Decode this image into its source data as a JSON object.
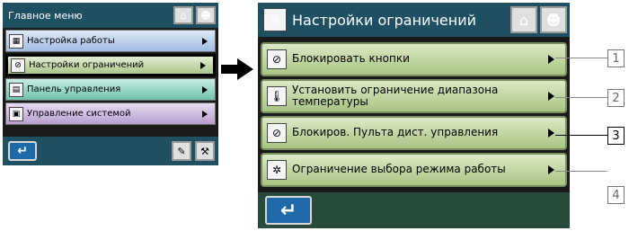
{
  "main_menu": {
    "title": "Главное меню",
    "items": [
      {
        "label": "Настройка работы",
        "icon": "settings-icon"
      },
      {
        "label": "Настройки ограничений",
        "icon": "restriction-icon"
      },
      {
        "label": "Панель управления",
        "icon": "panel-icon"
      },
      {
        "label": "Управление системой",
        "icon": "system-icon"
      }
    ]
  },
  "restrictions": {
    "title": "Настройки ограничений",
    "items": [
      {
        "label": "Блокировать кнопки",
        "icon": "button-lock-icon"
      },
      {
        "label": "Установить ограничение диапазона температуры",
        "icon": "thermometer-icon"
      },
      {
        "label": "Блокиров. Пульта дист. управления",
        "icon": "remote-lock-icon"
      },
      {
        "label": "Ограничение выбора режима работы",
        "icon": "mode-restrict-icon"
      }
    ]
  },
  "callouts": [
    "1",
    "2",
    "3",
    "4"
  ],
  "icons": {
    "home": "⌂",
    "user": "☻",
    "back": "↵"
  },
  "colors": {
    "header": "#1e4f63",
    "item_green": "#a9c483",
    "back_blue": "#1e6aa8"
  }
}
